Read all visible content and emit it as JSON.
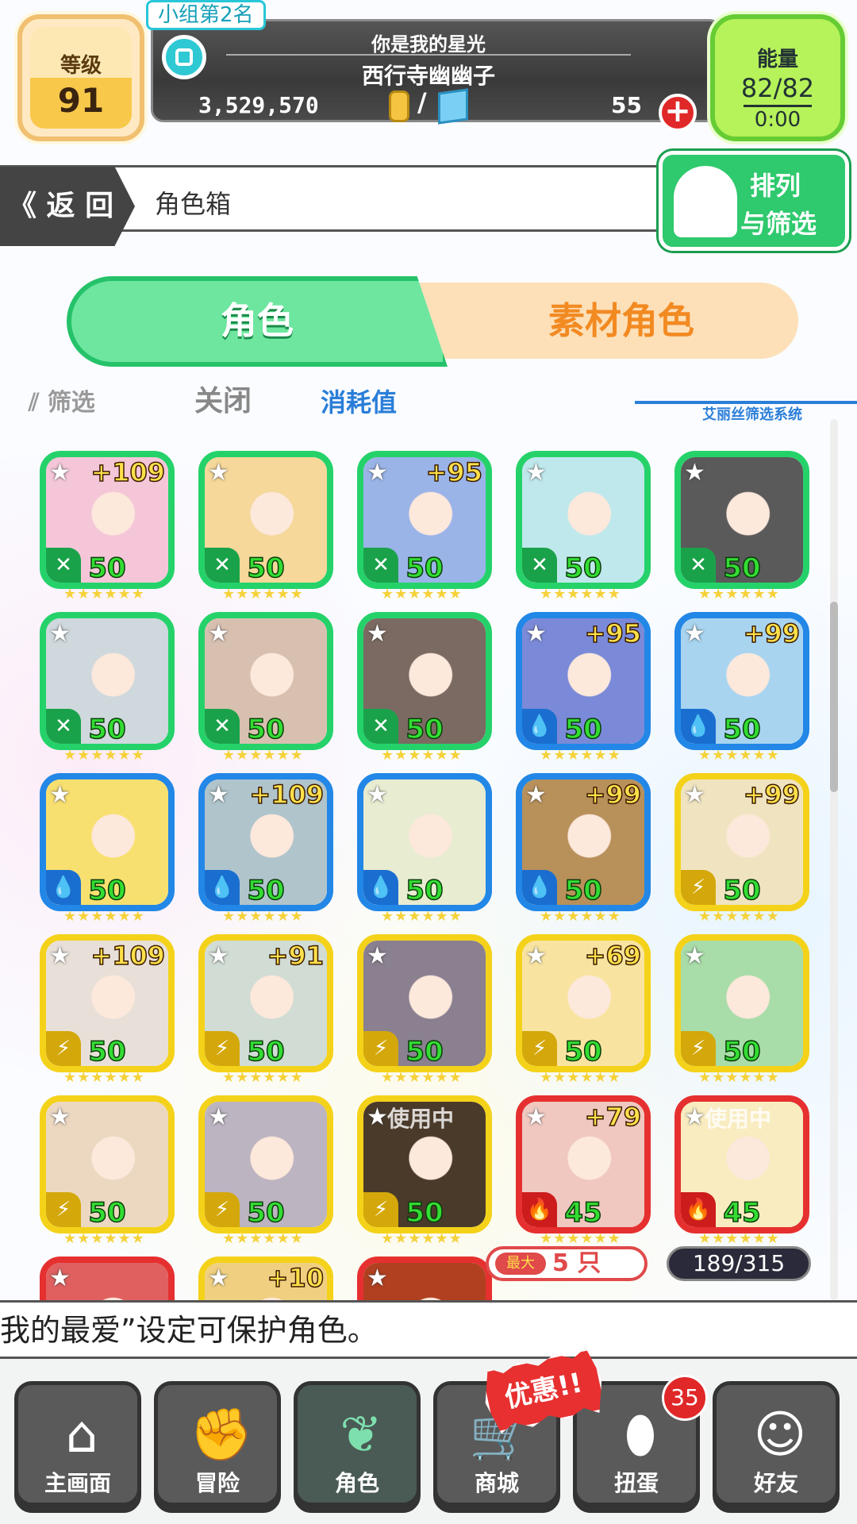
{
  "header": {
    "level_label": "等级",
    "level_value": "91",
    "group_rank": "小组第2名",
    "player_title": "你是我的星光",
    "player_name": "西行寺幽幽子",
    "gold": "3,529,570",
    "currency_slash": "/",
    "gems": "55",
    "energy_label": "能量",
    "energy_value": "82/82",
    "energy_timer": "0:00"
  },
  "nav": {
    "back_label": "《 返 回",
    "title": "角色箱",
    "sort_line1": "排列",
    "sort_line2": "与筛选"
  },
  "tabs": {
    "characters": "角色",
    "materials": "素材角色"
  },
  "filter": {
    "filter_label": "筛选",
    "close_label": "关闭",
    "cost_label": "消耗值",
    "system_label": "艾丽丝筛选系统"
  },
  "cards": [
    {
      "color": "g",
      "plus": "+109",
      "cost": "50",
      "el": "✕",
      "use": ""
    },
    {
      "color": "g",
      "plus": "",
      "cost": "50",
      "el": "✕",
      "use": ""
    },
    {
      "color": "g",
      "plus": "+95",
      "cost": "50",
      "el": "✕",
      "use": ""
    },
    {
      "color": "g",
      "plus": "",
      "cost": "50",
      "el": "✕",
      "use": ""
    },
    {
      "color": "g",
      "plus": "",
      "cost": "50",
      "el": "✕",
      "use": ""
    },
    {
      "color": "g",
      "plus": "",
      "cost": "50",
      "el": "✕",
      "use": ""
    },
    {
      "color": "g",
      "plus": "",
      "cost": "50",
      "el": "✕",
      "use": ""
    },
    {
      "color": "g",
      "plus": "",
      "cost": "50",
      "el": "✕",
      "use": ""
    },
    {
      "color": "b",
      "plus": "+95",
      "cost": "50",
      "el": "💧",
      "use": ""
    },
    {
      "color": "b",
      "plus": "+99",
      "cost": "50",
      "el": "💧",
      "use": ""
    },
    {
      "color": "b",
      "plus": "",
      "cost": "50",
      "el": "💧",
      "use": ""
    },
    {
      "color": "b",
      "plus": "+109",
      "cost": "50",
      "el": "💧",
      "use": ""
    },
    {
      "color": "b",
      "plus": "",
      "cost": "50",
      "el": "💧",
      "use": ""
    },
    {
      "color": "b",
      "plus": "+99",
      "cost": "50",
      "el": "💧",
      "use": ""
    },
    {
      "color": "y",
      "plus": "+99",
      "cost": "50",
      "el": "⚡",
      "use": ""
    },
    {
      "color": "y",
      "plus": "+109",
      "cost": "50",
      "el": "⚡",
      "use": ""
    },
    {
      "color": "y",
      "plus": "+91",
      "cost": "50",
      "el": "⚡",
      "use": ""
    },
    {
      "color": "y",
      "plus": "",
      "cost": "50",
      "el": "⚡",
      "use": ""
    },
    {
      "color": "y",
      "plus": "+69",
      "cost": "50",
      "el": "⚡",
      "use": ""
    },
    {
      "color": "y",
      "plus": "",
      "cost": "50",
      "el": "⚡",
      "use": ""
    },
    {
      "color": "y",
      "plus": "",
      "cost": "50",
      "el": "⚡",
      "use": ""
    },
    {
      "color": "y",
      "plus": "",
      "cost": "50",
      "el": "⚡",
      "use": ""
    },
    {
      "color": "y",
      "plus": "",
      "cost": "50",
      "el": "⚡",
      "use": "使用中"
    },
    {
      "color": "r",
      "plus": "+79",
      "cost": "45",
      "el": "🔥",
      "use": ""
    },
    {
      "color": "r",
      "plus": "",
      "cost": "45",
      "el": "🔥",
      "use": "使用中"
    },
    {
      "color": "r",
      "plus": "",
      "cost": "",
      "el": "",
      "use": ""
    },
    {
      "color": "y",
      "plus": "+10",
      "cost": "",
      "el": "",
      "use": ""
    },
    {
      "color": "r",
      "plus": "",
      "cost": "",
      "el": "",
      "use": ""
    }
  ],
  "counters": {
    "max_label": "最大",
    "max_value": "5 只",
    "box_count": "189/315"
  },
  "ticker": "我的最爱”设定可保护角色。",
  "bottom_nav": {
    "home": "主画面",
    "adventure": "冒险",
    "characters": "角色",
    "shop": "商城",
    "gacha": "扭蛋",
    "friends": "好友",
    "promo": "优惠!!",
    "gacha_badge": "35"
  },
  "colors": {
    "green": "#25d26a",
    "blue": "#2287e6",
    "yellow": "#f4d21a",
    "red": "#e63030"
  }
}
